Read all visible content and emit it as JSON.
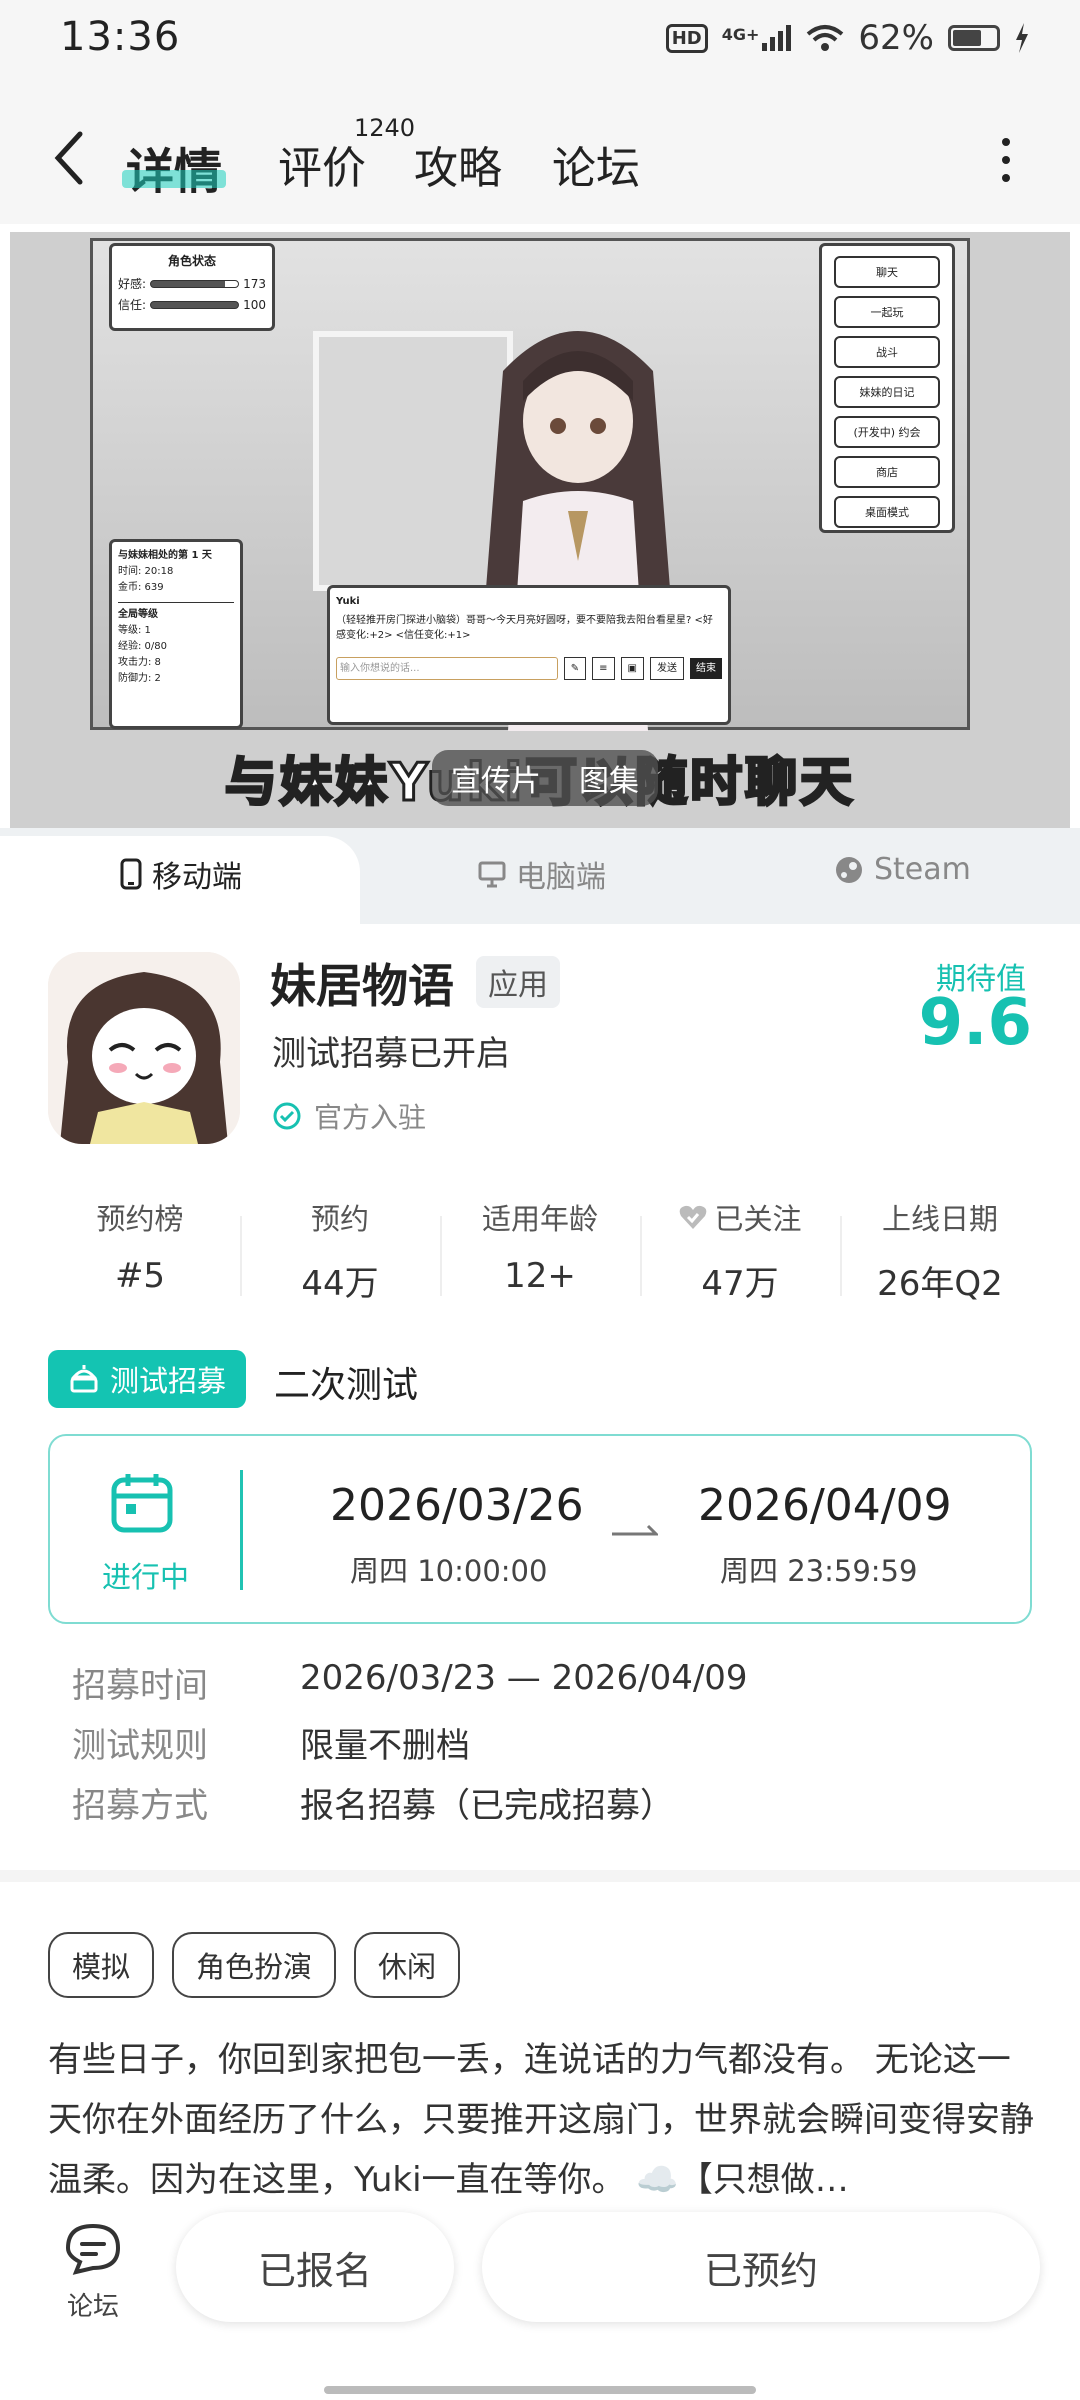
{
  "status_bar": {
    "time": "13:36",
    "hd": "HD",
    "network": "4G+",
    "battery": "62%"
  },
  "nav": {
    "tabs": [
      {
        "label": "详情"
      },
      {
        "label": "评价"
      },
      {
        "label": "攻略"
      },
      {
        "label": "论坛"
      }
    ],
    "review_count": "1240"
  },
  "banner": {
    "caption": "与妹妹Yuki可以随时聊天",
    "segments": [
      "宣传片",
      "图集"
    ],
    "status_panel": {
      "title": "角色状态",
      "favor_label": "好感:",
      "favor_value": "173",
      "trust_label": "信任:",
      "trust_value": "100"
    },
    "menu": [
      "聊天",
      "一起玩",
      "战斗",
      "妹妹的日记",
      "(开发中) 约会",
      "商店",
      "桌面模式"
    ],
    "day_panel": {
      "line1": "与妹妹相处的第 1 天",
      "line2": "时间: 20:18",
      "line3": "金币: 639",
      "line4": "全局等级",
      "line5": "等级: 1",
      "line6": "经验: 0/80",
      "line7": "攻击力: 8",
      "line8": "防御力: 2"
    },
    "dialog": {
      "speaker": "Yuki",
      "text": "（轻轻推开房门探进小脑袋）哥哥～今天月亮好圆呀，要不要陪我去阳台看星星? <好感变化:+2> <信任变化:+1>",
      "placeholder": "输入你想说的话...",
      "send": "发送",
      "end": "结束"
    }
  },
  "platform_tabs": [
    {
      "label": "移动端"
    },
    {
      "label": "电脑端"
    },
    {
      "label": "Steam"
    }
  ],
  "app": {
    "name": "妹居物语",
    "type_badge": "应用",
    "subtitle": "测试招募已开启",
    "official": "官方入驻",
    "score_label": "期待值",
    "score": "9.6"
  },
  "stats": [
    {
      "label": "预约榜",
      "value": "#5"
    },
    {
      "label": "预约",
      "value": "44万"
    },
    {
      "label": "适用年龄",
      "value": "12+"
    },
    {
      "label": "已关注",
      "value": "47万"
    },
    {
      "label": "上线日期",
      "value": "26年Q2"
    }
  ],
  "recruit": {
    "tag": "测试招募",
    "title": "二次测试",
    "status": "进行中",
    "start_date": "2026/03/26",
    "start_time": "周四  10:00:00",
    "end_date": "2026/04/09",
    "end_time": "周四  23:59:59",
    "rows": [
      {
        "label": "招募时间",
        "value": "2026/03/23 — 2026/04/09"
      },
      {
        "label": "测试规则",
        "value": "限量不删档"
      },
      {
        "label": "招募方式",
        "value": "报名招募（已完成招募）"
      }
    ]
  },
  "tags": [
    "模拟",
    "角色扮演",
    "休闲"
  ],
  "description": "有些日子，你回到家把包一丢，连说话的力气都没有。 无论这一天你在外面经历了什么，只要推开这扇门，世界就会瞬间变得安静温柔。因为在这里，Yuki一直在等你。 ☁️【只想做…",
  "bottom": {
    "forum_label": "论坛",
    "btn_registered": "已报名",
    "btn_reserved": "已预约"
  },
  "colors": {
    "accent": "#17c1b1"
  }
}
